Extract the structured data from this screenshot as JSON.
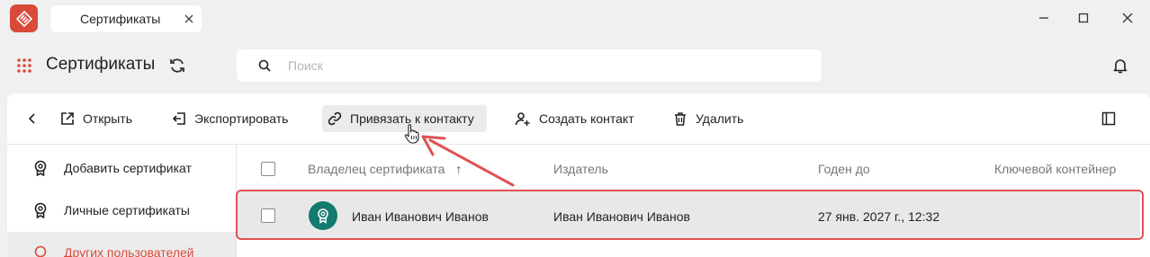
{
  "window": {
    "tab_title": "Сертификаты"
  },
  "header": {
    "title": "Сертификаты",
    "search_placeholder": "Поиск"
  },
  "toolbar": {
    "open_label": "Открыть",
    "export_label": "Экспортировать",
    "link_contact_label": "Привязать к контакту",
    "create_contact_label": "Создать контакт",
    "delete_label": "Удалить"
  },
  "sidebar": {
    "items": [
      {
        "label": "Добавить сертификат"
      },
      {
        "label": "Личные сертификаты"
      },
      {
        "label": "Других пользователей"
      }
    ]
  },
  "table": {
    "columns": [
      "Владелец сертификата",
      "Издатель",
      "Годен до",
      "Ключевой контейнер"
    ],
    "sort_indicator": "↑",
    "rows": [
      {
        "owner": "Иван Иванович Иванов",
        "issuer": "Иван Иванович Иванов",
        "valid_until": "27 янв. 2027 г., 12:32",
        "container": ""
      }
    ]
  },
  "colors": {
    "accent": "#d94a3a",
    "avatar": "#127a6e",
    "annotation": "#e05252"
  }
}
